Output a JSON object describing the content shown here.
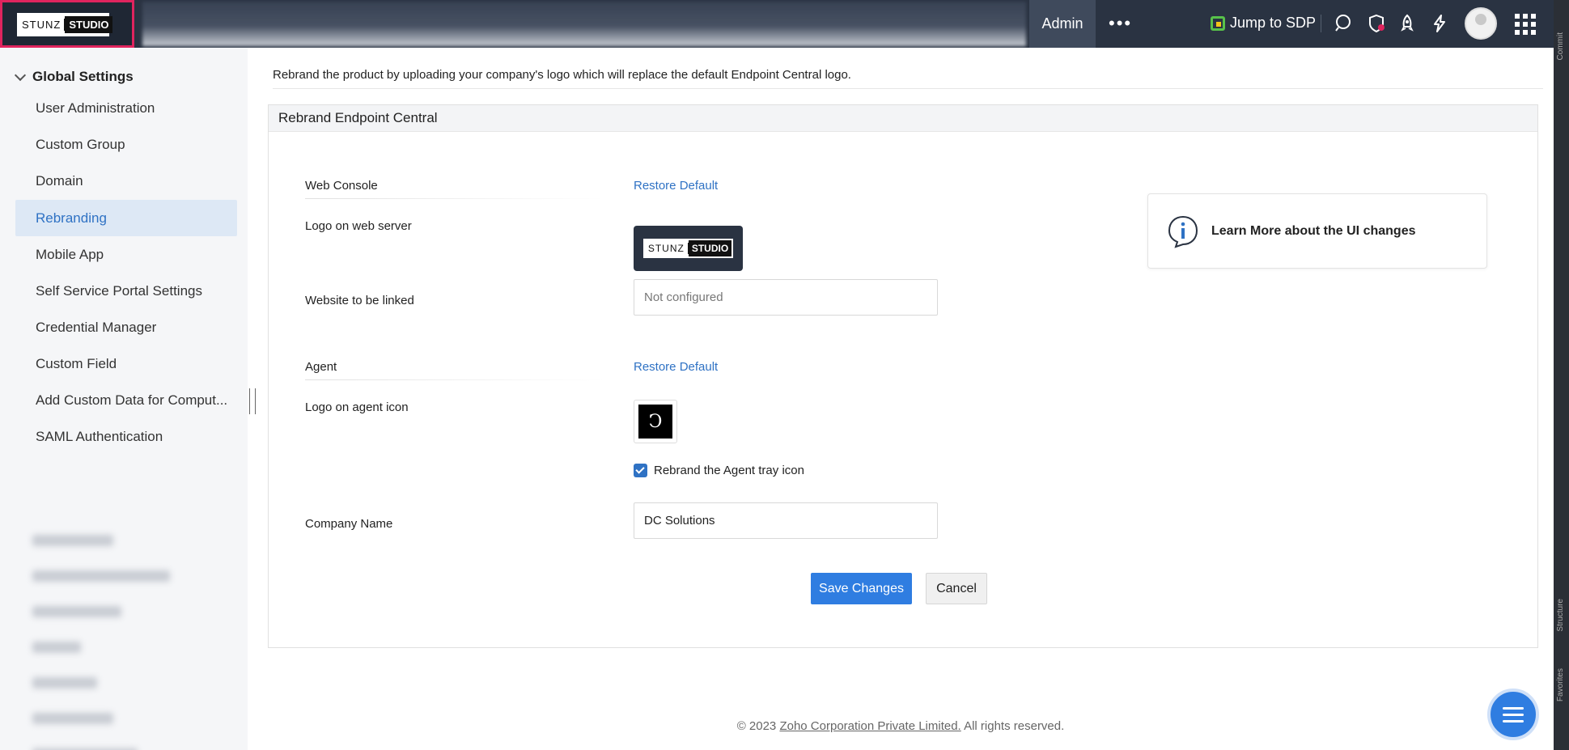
{
  "header": {
    "logo": {
      "left_text": "STUNZ",
      "right_text": "STUDIO"
    },
    "admin_tab": "Admin",
    "more": "•••",
    "jump_to_sdp": "Jump to SDP",
    "icons": [
      "search-icon",
      "shield-alert-icon",
      "rocket-icon",
      "lightning-icon",
      "avatar",
      "apps-grid-icon"
    ]
  },
  "right_strip": {
    "commit": "Commit",
    "structure": "Structure",
    "favorites": "Favorites"
  },
  "sidebar": {
    "group_title": "Global Settings",
    "items": [
      {
        "label": "User Administration"
      },
      {
        "label": "Custom Group"
      },
      {
        "label": "Domain"
      },
      {
        "label": "Rebranding",
        "active": true
      },
      {
        "label": "Mobile App"
      },
      {
        "label": "Self Service Portal Settings"
      },
      {
        "label": "Credential Manager"
      },
      {
        "label": "Custom Field"
      },
      {
        "label": "Add Custom Data for Comput..."
      },
      {
        "label": "SAML Authentication"
      }
    ]
  },
  "main": {
    "description": "Rebrand the product by uploading your company's logo which will replace the default Endpoint Central logo.",
    "panel_title": "Rebrand Endpoint Central",
    "web_console": {
      "label": "Web Console",
      "restore": "Restore Default",
      "logo_label": "Logo on web server",
      "website_label": "Website to be linked",
      "website_placeholder": "Not configured",
      "website_value": ""
    },
    "agent": {
      "label": "Agent",
      "restore": "Restore Default",
      "logo_label": "Logo on agent icon",
      "agent_icon_glyph": "Ͻ",
      "tray_checkbox_label": "Rebrand the Agent tray icon",
      "tray_checked": true
    },
    "company": {
      "label": "Company Name",
      "value": "DC Solutions"
    },
    "buttons": {
      "save": "Save Changes",
      "cancel": "Cancel"
    },
    "learn_more": "Learn More about the UI changes"
  },
  "footer": {
    "prefix": "© 2023 ",
    "company": "Zoho Corporation Private Limited.",
    "suffix": " All rights reserved."
  },
  "colors": {
    "accent": "#2f7de1",
    "link": "#2f72c4",
    "topbar": "#2a3342",
    "active_bg": "#dde8f5",
    "highlight_border": "#e0245e"
  }
}
